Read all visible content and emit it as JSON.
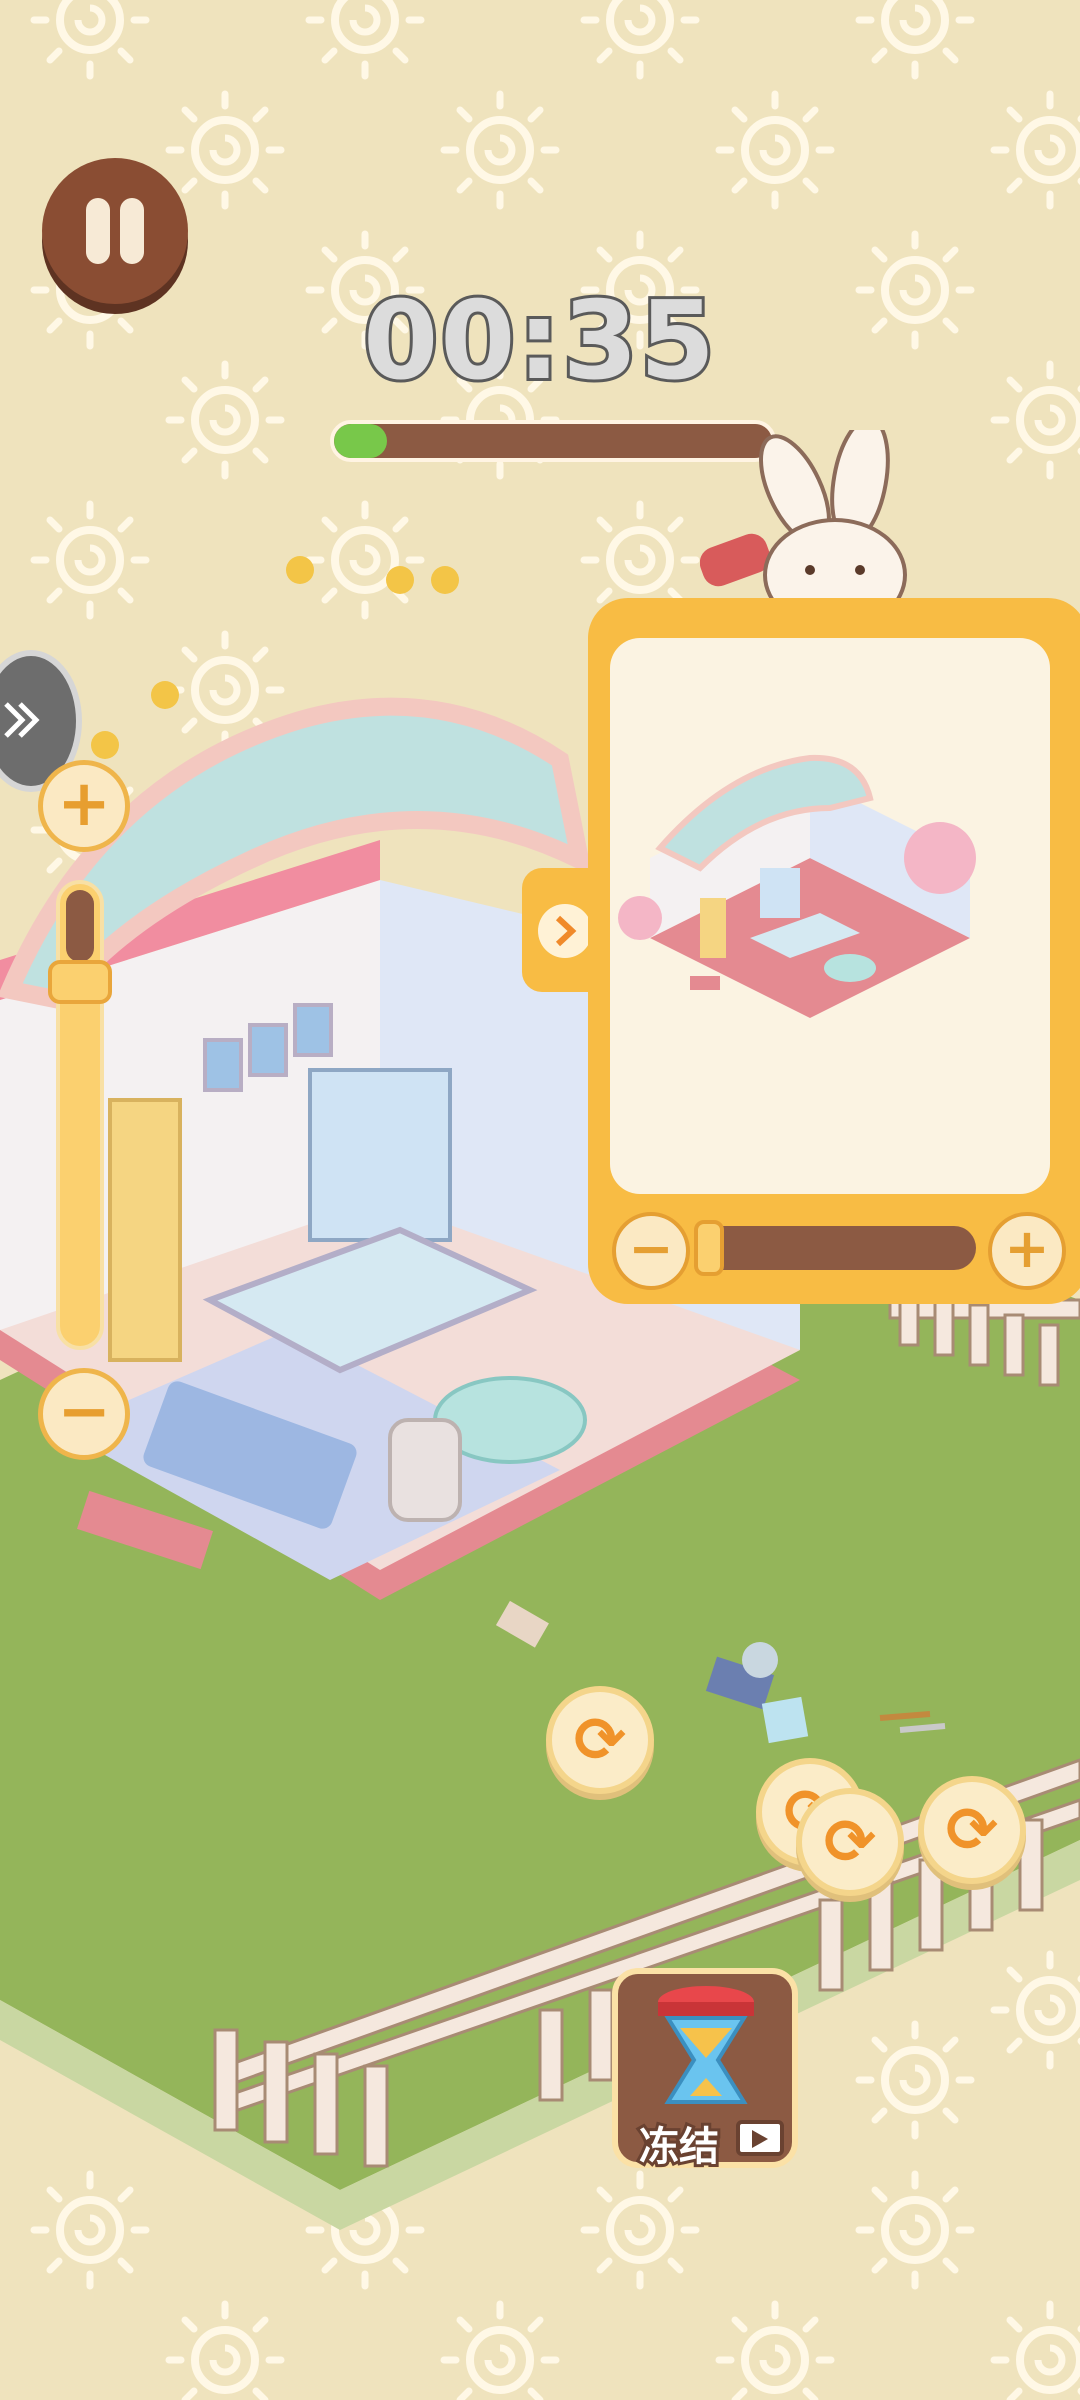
{
  "hud": {
    "timer": "00:35",
    "time_progress": 0.12,
    "pause_icon": "pause-icon",
    "side_arrow_icon": "double-chevron-right-icon"
  },
  "zoom_slider": {
    "plus_label": "+",
    "minus_label": "−",
    "level": 0.15
  },
  "preview_panel": {
    "toggle_icon": "chevron-right-icon",
    "minus_label": "−",
    "plus_label": "+",
    "level": 0.05
  },
  "refresh_coins": {
    "glyph": "⟳",
    "count": 4
  },
  "freeze_button": {
    "label": "冻结",
    "icon": "hourglass-icon",
    "ad_icon": "video-ad-icon"
  },
  "colors": {
    "background": "#efe3bd",
    "grass": "#94b55a",
    "accent_orange": "#f8bc44",
    "brown": "#8c5a43",
    "progress_green": "#78c84a"
  }
}
